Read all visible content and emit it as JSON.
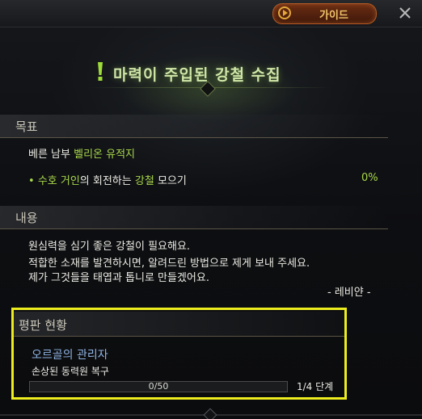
{
  "header": {
    "guide_label": "가이드",
    "close_label": "X"
  },
  "quest": {
    "title": "마력이 주입된 강철 수집"
  },
  "objective": {
    "section_title": "목표",
    "location_prefix": "베른 남부",
    "location_name": "벨리온 유적지",
    "task_bullet": "•",
    "task_monster": "수호 거인",
    "task_mid": "의 회전하는",
    "task_item": "강철",
    "task_suffix": "모으기",
    "progress": "0%"
  },
  "content": {
    "section_title": "내용",
    "lines": [
      "원심력을 심기 좋은 강철이 필요해요.",
      "적합한 소재를 발견하시면, 알려드린 방법으로 제게 보내 주세요.",
      "제가 그것들을 태엽과 톱니로 만들겠어요."
    ],
    "signature": "- 레비얀 -"
  },
  "reputation": {
    "section_title": "평판 현황",
    "npc_name": "오르골의 관리자",
    "task": "손상된 동력원 복구",
    "progress_text": "0/50",
    "progress_value": 0,
    "progress_max": 50,
    "stage": "1/4 단계"
  },
  "colors": {
    "highlight_green": "#a8d84a",
    "npc_blue": "#8fb3e2",
    "guide_orange": "#f1c46a",
    "annotation_yellow": "#ecec1e"
  }
}
